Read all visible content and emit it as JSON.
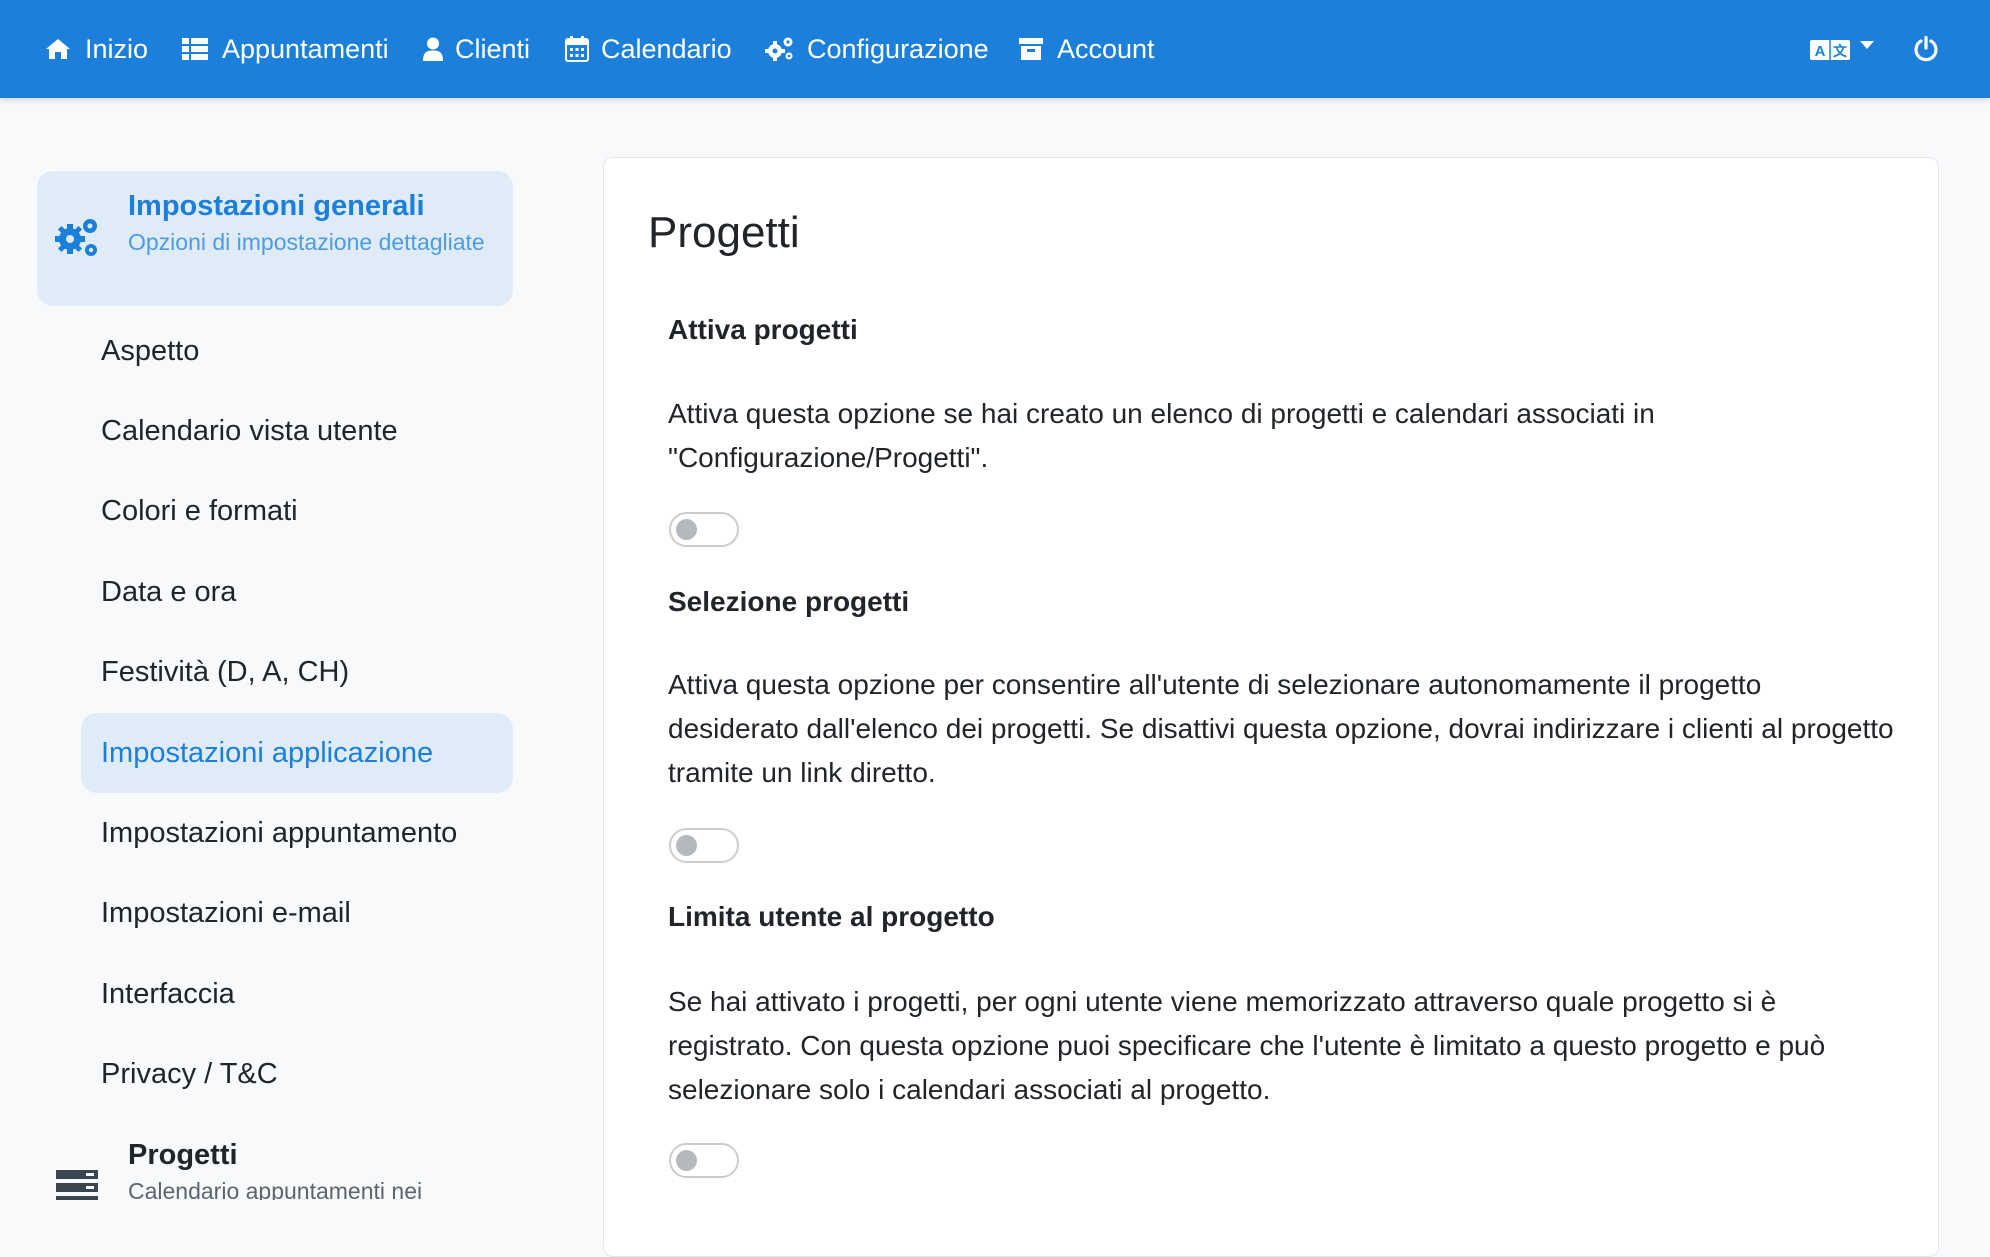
{
  "navbar": {
    "items": [
      {
        "label": "Inizio",
        "icon": "home-icon"
      },
      {
        "label": "Appuntamenti",
        "icon": "list-icon"
      },
      {
        "label": "Clienti",
        "icon": "user-icon"
      },
      {
        "label": "Calendario",
        "icon": "calendar-icon"
      },
      {
        "label": "Configurazione",
        "icon": "gears-icon"
      },
      {
        "label": "Account",
        "icon": "archive-icon"
      }
    ],
    "language_icon": "translate-icon",
    "power_icon": "power-icon",
    "background": "#1c7fd9"
  },
  "sidebar": {
    "general": {
      "title": "Impostazioni generali",
      "subtitle": "Opzioni di impostazione dettagliate",
      "icon": "gears-icon"
    },
    "items": [
      {
        "label": "Aspetto"
      },
      {
        "label": "Calendario vista utente"
      },
      {
        "label": "Colori e formati"
      },
      {
        "label": "Data e ora"
      },
      {
        "label": "Festività (D, A, CH)"
      },
      {
        "label": "Impostazioni applicazione",
        "active": true
      },
      {
        "label": "Impostazioni appuntamento"
      },
      {
        "label": "Impostazioni e-mail"
      },
      {
        "label": "Interfaccia"
      },
      {
        "label": "Privacy / T&C"
      }
    ],
    "projects": {
      "title": "Progetti",
      "subtitle": "Calendario appuntamenti nei",
      "icon": "server-icon"
    }
  },
  "main": {
    "title": "Progetti",
    "options": [
      {
        "title": "Attiva progetti",
        "description": "Attiva questa opzione se hai creato un elenco di progetti e calendari associati in \"Configurazione/Progetti\".",
        "enabled": false
      },
      {
        "title": "Selezione progetti",
        "description": "Attiva questa opzione per consentire all'utente di selezionare autonomamente il progetto desiderato dall'elenco dei progetti. Se disattivi questa opzione, dovrai indirizzare i clienti al progetto tramite un link diretto.",
        "enabled": false
      },
      {
        "title": "Limita utente al progetto",
        "description": "Se hai attivato i progetti, per ogni utente viene memorizzato attraverso quale progetto si è registrato. Con questa opzione puoi specificare che l'utente è limitato a questo progetto e può selezionare solo i calendari associati al progetto.",
        "enabled": false
      }
    ]
  },
  "colors": {
    "accent": "#1c7fd9",
    "active_bg": "#dfecf8"
  }
}
